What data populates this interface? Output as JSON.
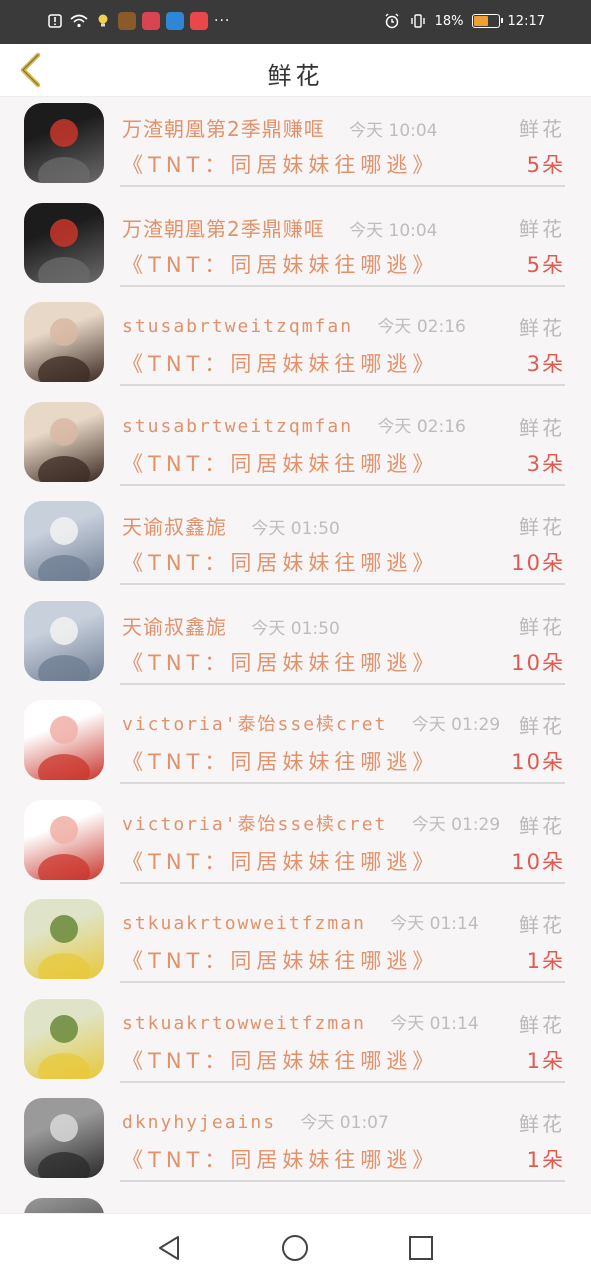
{
  "status_bar": {
    "battery_text": "18%",
    "time": "12:17",
    "more_dots": "···",
    "battery_level": 0.18
  },
  "header": {
    "title": "鲜花",
    "back_icon": "chevron-left-icon"
  },
  "book_title": "《TNT：同居妹妹往哪逃》",
  "gift_type": "鲜花",
  "entries": [
    {
      "user": "万渣朝凰第2季鼎赚哐",
      "time": "今天 10:04",
      "count": "5朵",
      "latin": false
    },
    {
      "user": "万渣朝凰第2季鼎赚哐",
      "time": "今天 10:04",
      "count": "5朵",
      "latin": false
    },
    {
      "user": "stusabrtweitzqmfan",
      "time": "今天 02:16",
      "count": "3朵",
      "latin": true
    },
    {
      "user": "stusabrtweitzqmfan",
      "time": "今天 02:16",
      "count": "3朵",
      "latin": true
    },
    {
      "user": "天谕叔鑫旎",
      "time": "今天 01:50",
      "count": "10朵",
      "latin": false
    },
    {
      "user": "天谕叔鑫旎",
      "time": "今天 01:50",
      "count": "10朵",
      "latin": false
    },
    {
      "user": "victoria'泰饴sse椟cret",
      "time": "今天 01:29",
      "count": "10朵",
      "latin": true
    },
    {
      "user": "victoria'泰饴sse椟cret",
      "time": "今天 01:29",
      "count": "10朵",
      "latin": true
    },
    {
      "user": "stkuakrtowweitfzman",
      "time": "今天 01:14",
      "count": "1朵",
      "latin": true
    },
    {
      "user": "stkuakrtowweitfzman",
      "time": "今天 01:14",
      "count": "1朵",
      "latin": true
    },
    {
      "user": "dknyhyjeains",
      "time": "今天 01:07",
      "count": "1朵",
      "latin": true
    }
  ],
  "colors": {
    "username": "#e1926a",
    "count": "#e05a4f",
    "muted": "#b9b9b9",
    "status_bar": "#3a3a3a"
  },
  "nav": {
    "back": "triangle-back-icon",
    "home": "circle-home-icon",
    "recents": "square-recents-icon"
  }
}
